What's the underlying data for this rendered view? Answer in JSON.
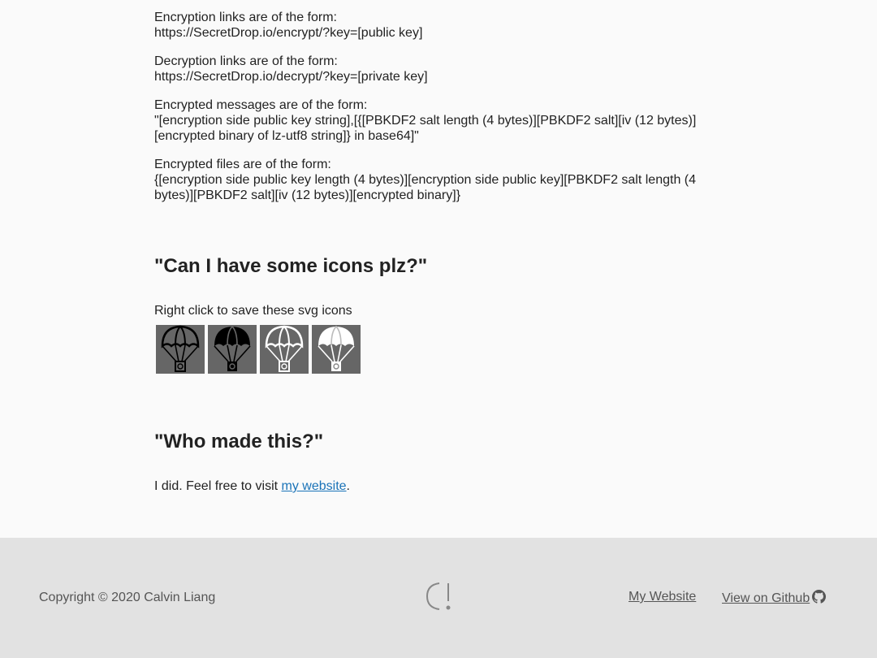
{
  "format_section": {
    "encrypt_label": "Encryption links are of the form:",
    "encrypt_value": "https://SecretDrop.io/encrypt/?key=[public key]",
    "decrypt_label": "Decryption links are of the form:",
    "decrypt_value": "https://SecretDrop.io/decrypt/?key=[private key]",
    "messages_label": "Encrypted messages are of the form:",
    "messages_value": "\"[encryption side public key string],[{[PBKDF2 salt length (4 bytes)][PBKDF2 salt][iv (12 bytes)][encrypted binary of lz-utf8 string]} in base64]\"",
    "files_label": "Encrypted files are of the form:",
    "files_value": "{[encryption side public key length (4 bytes)][encryption side public key][PBKDF2 salt length (4 bytes)][PBKDF2 salt][iv (12 bytes)][encrypted binary]}"
  },
  "icons_section": {
    "heading": "\"Can I have some icons plz?\"",
    "text": "Right click to save these svg icons",
    "icons": [
      "parachute-icon-dark-outline",
      "parachute-icon-dark-filled",
      "parachute-icon-light-outline",
      "parachute-icon-light-filled"
    ]
  },
  "who_section": {
    "heading": "\"Who made this?\"",
    "text_before": "I did. Feel free to visit ",
    "link": "my website",
    "text_after": "."
  },
  "footer": {
    "copyright": "Copyright © 2020 Calvin Liang",
    "website_link": "My Website",
    "github_link": "View on Github"
  },
  "colors": {
    "background": "#fafafa",
    "footer_background": "#e2e2e2",
    "link": "#1a73b8",
    "icon_tile": "#666666"
  }
}
